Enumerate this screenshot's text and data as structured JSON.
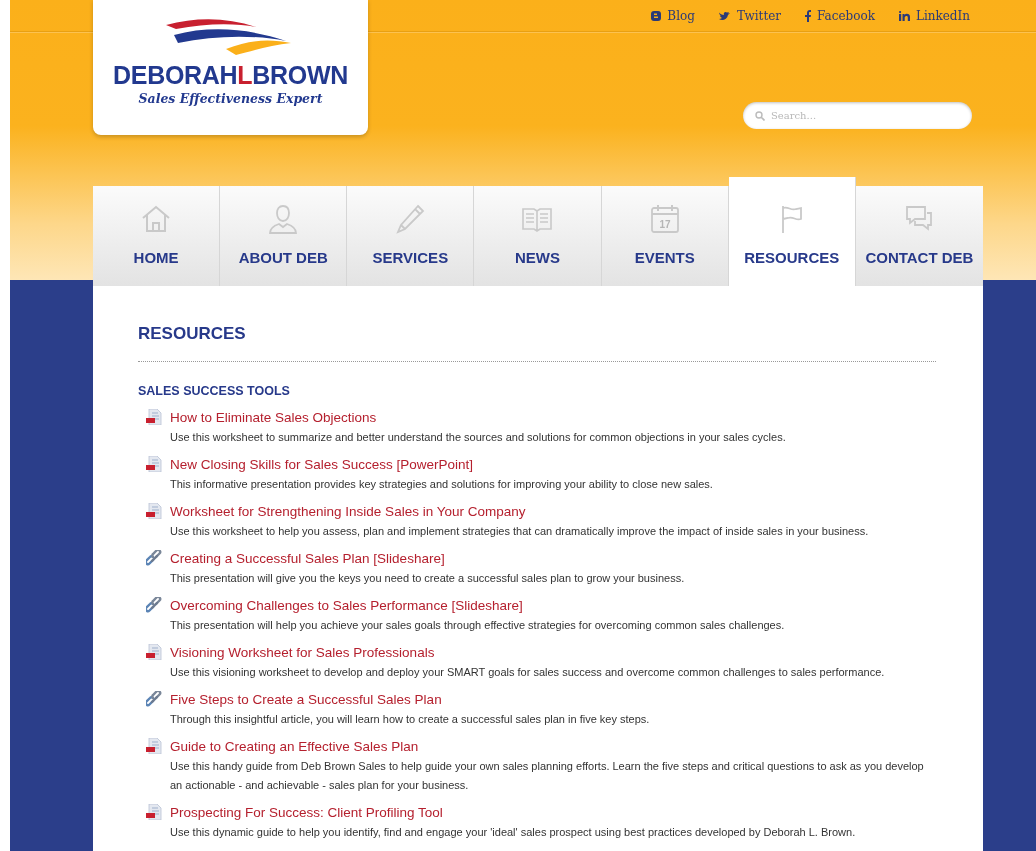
{
  "top_links": [
    {
      "kind": "blogger",
      "label": "Blog"
    },
    {
      "kind": "twitter",
      "label": "Twitter"
    },
    {
      "kind": "facebook",
      "label": "Facebook"
    },
    {
      "kind": "linkedin",
      "label": "LinkedIn"
    }
  ],
  "logo": {
    "name_first": "DEBORAH",
    "name_initial": "L",
    "name_last": "BROWN",
    "tagline": "Sales Effectiveness Expert"
  },
  "search": {
    "placeholder": "Search..."
  },
  "nav": [
    {
      "kind": "home",
      "label": "HOME",
      "selected": false
    },
    {
      "kind": "person",
      "label": "ABOUT DEB",
      "selected": false
    },
    {
      "kind": "pencil",
      "label": "SERVICES",
      "selected": false
    },
    {
      "kind": "book",
      "label": "NEWS",
      "selected": false
    },
    {
      "kind": "calendar",
      "label": "EVENTS",
      "selected": false,
      "icon_text": "17"
    },
    {
      "kind": "flag",
      "label": "RESOURCES",
      "selected": true
    },
    {
      "kind": "chat",
      "label": "CONTACT DEB",
      "selected": false
    }
  ],
  "page_title": "RESOURCES",
  "section_title": "SALES SUCCESS TOOLS",
  "resources": [
    {
      "kind": "document",
      "title": "How to Eliminate Sales Objections",
      "description": "Use this worksheet to summarize and better understand the sources and solutions for common objections in your sales cycles."
    },
    {
      "kind": "document",
      "title": "New Closing Skills for Sales Success [PowerPoint]",
      "description": "This informative presentation provides key strategies and solutions for improving your ability to close new sales."
    },
    {
      "kind": "document",
      "title": "Worksheet for Strengthening Inside Sales in Your Company",
      "description": "Use this worksheet to help you assess, plan and implement strategies that can dramatically improve the impact of inside sales in your business."
    },
    {
      "kind": "link",
      "title": "Creating a Successful Sales Plan [Slideshare]",
      "description": "This presentation will give you the keys you need to create a successful sales plan to grow your business."
    },
    {
      "kind": "link",
      "title": "Overcoming Challenges to Sales Performance [Slideshare]",
      "description": "This presentation will help you achieve your sales goals through effective strategies for overcoming common sales challenges."
    },
    {
      "kind": "document",
      "title": "Visioning Worksheet for Sales Professionals",
      "description": "Use this visioning worksheet to develop and deploy your SMART goals for sales success and overcome common challenges to sales performance."
    },
    {
      "kind": "link",
      "title": "Five Steps to Create a Successful Sales Plan",
      "description": "Through this insightful article, you will learn how to create a successful sales plan in five key steps."
    },
    {
      "kind": "document",
      "title": "Guide to Creating an Effective Sales Plan",
      "description": "Use this handy guide from Deb Brown Sales to help guide your own sales planning efforts. Learn the five steps and critical questions to ask as you develop an actionable - and achievable - sales plan for your business."
    },
    {
      "kind": "document",
      "title": "Prospecting For Success: Client Profiling Tool",
      "description": "Use this dynamic guide to help you identify, find and engage your 'ideal' sales prospect using best practices developed by Deborah L. Brown."
    }
  ]
}
